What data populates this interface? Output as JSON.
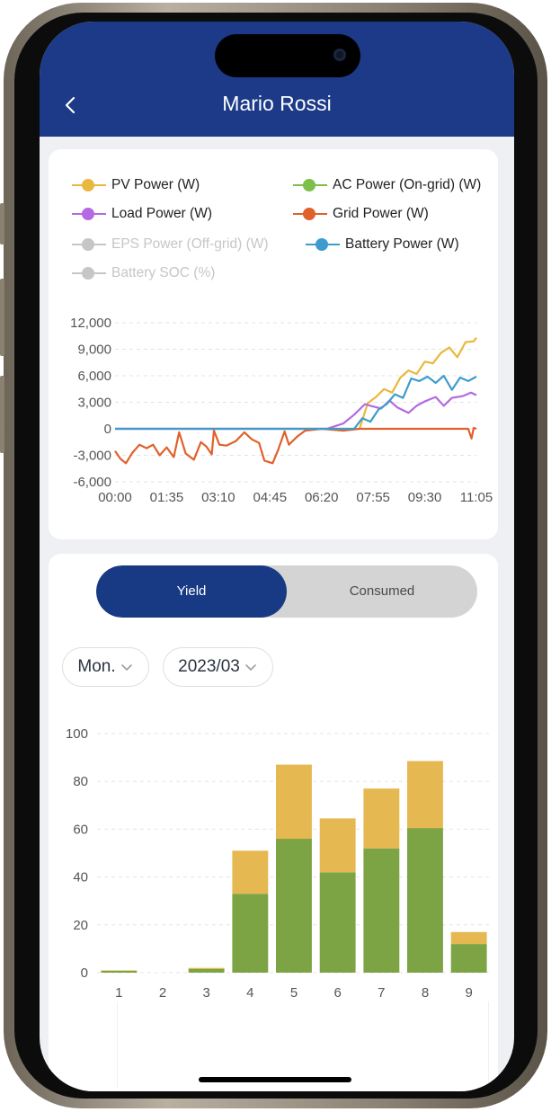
{
  "header": {
    "title": "Mario Rossi",
    "back_icon": "chevron-left-icon",
    "background": "#1c3a87"
  },
  "power_chart": {
    "legend": [
      {
        "label": "PV Power (W)",
        "color": "#e9b83e",
        "enabled": true
      },
      {
        "label": "AC Power (On-grid) (W)",
        "color": "#7cbf4a",
        "enabled": true
      },
      {
        "label": "Load Power (W)",
        "color": "#b36ae2",
        "enabled": true
      },
      {
        "label": "Grid Power (W)",
        "color": "#e0612b",
        "enabled": true
      },
      {
        "label": "EPS Power (Off-grid) (W)",
        "color": "#c6c6c6",
        "enabled": false
      },
      {
        "label": "Battery Power (W)",
        "color": "#3d9ccc",
        "enabled": true
      },
      {
        "label": "Battery SOC (%)",
        "color": "#c6c6c6",
        "enabled": false
      }
    ]
  },
  "tabs": {
    "active": "Yield",
    "inactive": "Consumed"
  },
  "filters": {
    "period": "Mon.",
    "month": "2023/03"
  },
  "chart_data": [
    {
      "type": "line",
      "x_tick_labels": [
        "00:00",
        "01:35",
        "03:10",
        "04:45",
        "06:20",
        "07:55",
        "09:30",
        "11:05"
      ],
      "x_range_minutes": [
        0,
        665
      ],
      "ylim": [
        -6000,
        12000
      ],
      "y_tick_labels": [
        "12,000",
        "9,000",
        "6,000",
        "3,000",
        "0",
        "-3,000",
        "-6,000"
      ],
      "grid": true,
      "series": [
        {
          "name": "PV Power (W)",
          "color": "#e9b83e",
          "points": [
            [
              0,
              0
            ],
            [
              420,
              0
            ],
            [
              450,
              0
            ],
            [
              465,
              2900
            ],
            [
              480,
              3600
            ],
            [
              495,
              4500
            ],
            [
              510,
              4100
            ],
            [
              525,
              5800
            ],
            [
              540,
              6600
            ],
            [
              555,
              6200
            ],
            [
              570,
              7600
            ],
            [
              585,
              7400
            ],
            [
              600,
              8600
            ],
            [
              615,
              9200
            ],
            [
              630,
              8100
            ],
            [
              645,
              9800
            ],
            [
              660,
              9900
            ],
            [
              665,
              10300
            ]
          ]
        },
        {
          "name": "Load Power (W)",
          "color": "#b36ae2",
          "points": [
            [
              0,
              0
            ],
            [
              390,
              0
            ],
            [
              420,
              600
            ],
            [
              440,
              1600
            ],
            [
              460,
              2800
            ],
            [
              470,
              2600
            ],
            [
              490,
              2300
            ],
            [
              505,
              3200
            ],
            [
              520,
              2400
            ],
            [
              540,
              1800
            ],
            [
              555,
              2600
            ],
            [
              570,
              3100
            ],
            [
              590,
              3600
            ],
            [
              605,
              2600
            ],
            [
              620,
              3500
            ],
            [
              640,
              3700
            ],
            [
              655,
              4100
            ],
            [
              665,
              3800
            ]
          ]
        },
        {
          "name": "Grid Power (W)",
          "color": "#e0612b",
          "points": [
            [
              0,
              -2500
            ],
            [
              10,
              -3400
            ],
            [
              20,
              -3900
            ],
            [
              32,
              -2700
            ],
            [
              45,
              -1800
            ],
            [
              58,
              -2200
            ],
            [
              70,
              -1800
            ],
            [
              82,
              -3000
            ],
            [
              95,
              -2100
            ],
            [
              108,
              -3200
            ],
            [
              118,
              -400
            ],
            [
              130,
              -2800
            ],
            [
              145,
              -3500
            ],
            [
              158,
              -1500
            ],
            [
              168,
              -2000
            ],
            [
              178,
              -2900
            ],
            [
              182,
              -200
            ],
            [
              192,
              -1800
            ],
            [
              205,
              -1900
            ],
            [
              222,
              -1400
            ],
            [
              238,
              -400
            ],
            [
              252,
              -1200
            ],
            [
              265,
              -1600
            ],
            [
              275,
              -3600
            ],
            [
              290,
              -3900
            ],
            [
              300,
              -2400
            ],
            [
              312,
              -300
            ],
            [
              320,
              -1800
            ],
            [
              335,
              -900
            ],
            [
              350,
              -200
            ],
            [
              380,
              0
            ],
            [
              420,
              -200
            ],
            [
              450,
              0
            ],
            [
              520,
              0
            ],
            [
              600,
              0
            ],
            [
              650,
              0
            ],
            [
              656,
              -1100
            ],
            [
              660,
              100
            ],
            [
              665,
              0
            ]
          ]
        },
        {
          "name": "Battery Power (W)",
          "color": "#3d9ccc",
          "points": [
            [
              0,
              0
            ],
            [
              440,
              0
            ],
            [
              455,
              1200
            ],
            [
              470,
              800
            ],
            [
              485,
              2200
            ],
            [
              500,
              2800
            ],
            [
              515,
              3900
            ],
            [
              530,
              3500
            ],
            [
              545,
              5700
            ],
            [
              560,
              5400
            ],
            [
              575,
              5900
            ],
            [
              590,
              5200
            ],
            [
              605,
              6000
            ],
            [
              620,
              4400
            ],
            [
              635,
              5800
            ],
            [
              650,
              5400
            ],
            [
              665,
              5900
            ]
          ]
        }
      ]
    },
    {
      "type": "bar",
      "stacked": true,
      "categories": [
        "1",
        "2",
        "3",
        "4",
        "5",
        "6",
        "7",
        "8",
        "9"
      ],
      "ylim": [
        0,
        100
      ],
      "y_tick_labels": [
        "100",
        "80",
        "60",
        "40",
        "20",
        "0"
      ],
      "grid": true,
      "series": [
        {
          "color": "#7da444",
          "values": [
            0.8,
            0,
            1.5,
            33,
            56,
            42,
            52,
            60.5,
            12
          ]
        },
        {
          "color": "#e6b852",
          "values": [
            0.2,
            0,
            0.5,
            18,
            31,
            22.5,
            25,
            28,
            5
          ]
        }
      ]
    }
  ]
}
